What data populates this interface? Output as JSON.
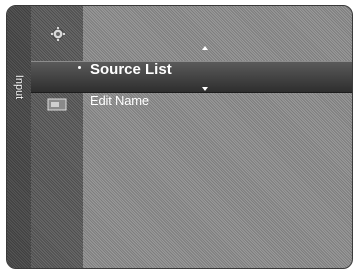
{
  "sidebar": {
    "title": "Input"
  },
  "icons": {
    "settings": "gear-icon",
    "input": "input-source-icon",
    "edit": "tv-icon"
  },
  "menu": {
    "items": [
      {
        "label": "Source List",
        "selected": true
      },
      {
        "label": "Edit Name",
        "selected": false
      }
    ]
  },
  "colors": {
    "background": "#8a8a8a",
    "sidebar": "#4b4b4b",
    "selected_bar": "#3a3a3a",
    "text": "#ffffff"
  }
}
